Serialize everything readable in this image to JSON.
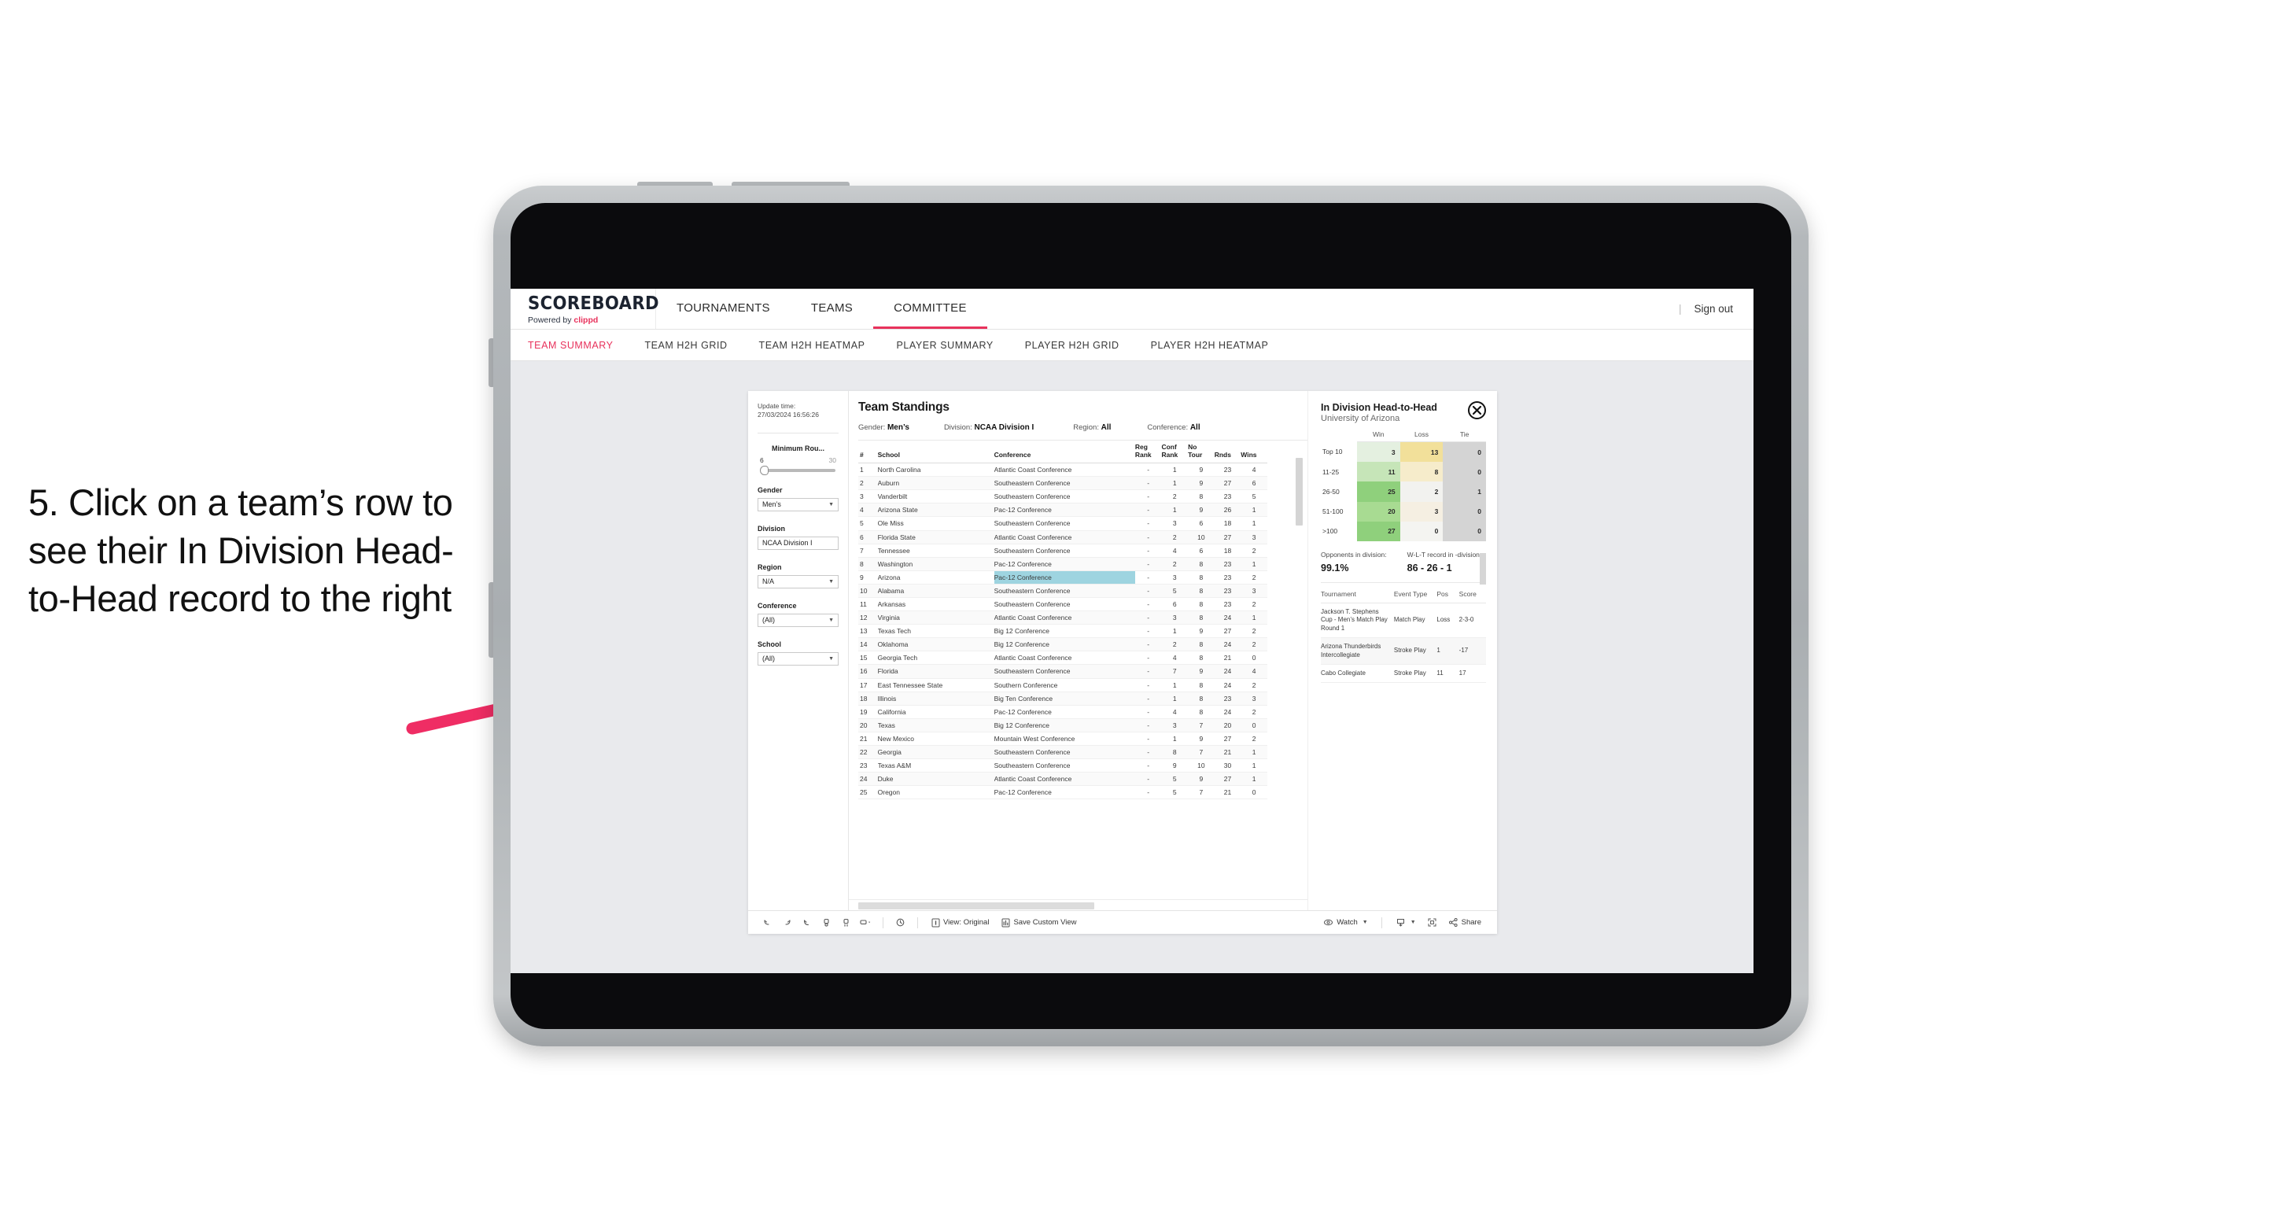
{
  "annotation": {
    "text": "5. Click on a team’s row to see their In Division Head-to-Head record to the right",
    "arrow_color": "#ef2d64"
  },
  "brand": {
    "logo_main": "SCOREBOARD",
    "logo_sub_prefix": "Powered by ",
    "logo_sub_brand": "clippd",
    "accent_color": "#e8325c"
  },
  "topnav": {
    "items": [
      {
        "label": "TOURNAMENTS",
        "active": false
      },
      {
        "label": "TEAMS",
        "active": false
      },
      {
        "label": "COMMITTEE",
        "active": true
      }
    ],
    "divider": "|",
    "sign_out": "Sign out"
  },
  "subnav": {
    "items": [
      {
        "label": "TEAM SUMMARY",
        "active": true
      },
      {
        "label": "TEAM H2H GRID",
        "active": false
      },
      {
        "label": "TEAM H2H HEATMAP",
        "active": false
      },
      {
        "label": "PLAYER SUMMARY",
        "active": false
      },
      {
        "label": "PLAYER H2H GRID",
        "active": false
      },
      {
        "label": "PLAYER H2H HEATMAP",
        "active": false
      }
    ]
  },
  "rail": {
    "update_label": "Update time:",
    "update_value": "27/03/2024 16:56:26",
    "slider": {
      "title": "Minimum Rou...",
      "min": "6",
      "max": "30"
    },
    "filters": [
      {
        "title": "Gender",
        "value": "Men’s"
      },
      {
        "title": "Division",
        "value": "NCAA Division I"
      },
      {
        "title": "Region",
        "value": "N/A"
      },
      {
        "title": "Conference",
        "value": "(All)"
      },
      {
        "title": "School",
        "value": "(All)"
      }
    ]
  },
  "standings": {
    "title": "Team Standings",
    "summary": [
      {
        "label": "Gender:",
        "value": "Men’s"
      },
      {
        "label": "Division:",
        "value": "NCAA Division I"
      },
      {
        "label": "Region:",
        "value": "All"
      },
      {
        "label": "Conference:",
        "value": "All"
      }
    ],
    "columns": [
      "#",
      "School",
      "Conference",
      "Reg Rank",
      "Conf Rank",
      "No Tour",
      "Rnds",
      "Wins"
    ],
    "column_lines": [
      [
        "#",
        ""
      ],
      [
        "School",
        ""
      ],
      [
        "Conference",
        ""
      ],
      [
        "Reg",
        "Rank"
      ],
      [
        "Conf",
        "Rank"
      ],
      [
        "No",
        "Tour"
      ],
      [
        "",
        "Rnds"
      ],
      [
        "",
        "Wins"
      ]
    ],
    "highlighted_row": 9,
    "rows": [
      {
        "n": "1",
        "school": "North Carolina",
        "conf": "Atlantic Coast Conference",
        "reg": "-",
        "cr": "1",
        "nt": "9",
        "rnds": "23",
        "wins": "4"
      },
      {
        "n": "2",
        "school": "Auburn",
        "conf": "Southeastern Conference",
        "reg": "-",
        "cr": "1",
        "nt": "9",
        "rnds": "27",
        "wins": "6"
      },
      {
        "n": "3",
        "school": "Vanderbilt",
        "conf": "Southeastern Conference",
        "reg": "-",
        "cr": "2",
        "nt": "8",
        "rnds": "23",
        "wins": "5"
      },
      {
        "n": "4",
        "school": "Arizona State",
        "conf": "Pac-12 Conference",
        "reg": "-",
        "cr": "1",
        "nt": "9",
        "rnds": "26",
        "wins": "1"
      },
      {
        "n": "5",
        "school": "Ole Miss",
        "conf": "Southeastern Conference",
        "reg": "-",
        "cr": "3",
        "nt": "6",
        "rnds": "18",
        "wins": "1"
      },
      {
        "n": "6",
        "school": "Florida State",
        "conf": "Atlantic Coast Conference",
        "reg": "-",
        "cr": "2",
        "nt": "10",
        "rnds": "27",
        "wins": "3"
      },
      {
        "n": "7",
        "school": "Tennessee",
        "conf": "Southeastern Conference",
        "reg": "-",
        "cr": "4",
        "nt": "6",
        "rnds": "18",
        "wins": "2"
      },
      {
        "n": "8",
        "school": "Washington",
        "conf": "Pac-12 Conference",
        "reg": "-",
        "cr": "2",
        "nt": "8",
        "rnds": "23",
        "wins": "1"
      },
      {
        "n": "9",
        "school": "Arizona",
        "conf": "Pac-12 Conference",
        "reg": "-",
        "cr": "3",
        "nt": "8",
        "rnds": "23",
        "wins": "2"
      },
      {
        "n": "10",
        "school": "Alabama",
        "conf": "Southeastern Conference",
        "reg": "-",
        "cr": "5",
        "nt": "8",
        "rnds": "23",
        "wins": "3"
      },
      {
        "n": "11",
        "school": "Arkansas",
        "conf": "Southeastern Conference",
        "reg": "-",
        "cr": "6",
        "nt": "8",
        "rnds": "23",
        "wins": "2"
      },
      {
        "n": "12",
        "school": "Virginia",
        "conf": "Atlantic Coast Conference",
        "reg": "-",
        "cr": "3",
        "nt": "8",
        "rnds": "24",
        "wins": "1"
      },
      {
        "n": "13",
        "school": "Texas Tech",
        "conf": "Big 12 Conference",
        "reg": "-",
        "cr": "1",
        "nt": "9",
        "rnds": "27",
        "wins": "2"
      },
      {
        "n": "14",
        "school": "Oklahoma",
        "conf": "Big 12 Conference",
        "reg": "-",
        "cr": "2",
        "nt": "8",
        "rnds": "24",
        "wins": "2"
      },
      {
        "n": "15",
        "school": "Georgia Tech",
        "conf": "Atlantic Coast Conference",
        "reg": "-",
        "cr": "4",
        "nt": "8",
        "rnds": "21",
        "wins": "0"
      },
      {
        "n": "16",
        "school": "Florida",
        "conf": "Southeastern Conference",
        "reg": "-",
        "cr": "7",
        "nt": "9",
        "rnds": "24",
        "wins": "4"
      },
      {
        "n": "17",
        "school": "East Tennessee State",
        "conf": "Southern Conference",
        "reg": "-",
        "cr": "1",
        "nt": "8",
        "rnds": "24",
        "wins": "2"
      },
      {
        "n": "18",
        "school": "Illinois",
        "conf": "Big Ten Conference",
        "reg": "-",
        "cr": "1",
        "nt": "8",
        "rnds": "23",
        "wins": "3"
      },
      {
        "n": "19",
        "school": "California",
        "conf": "Pac-12 Conference",
        "reg": "-",
        "cr": "4",
        "nt": "8",
        "rnds": "24",
        "wins": "2"
      },
      {
        "n": "20",
        "school": "Texas",
        "conf": "Big 12 Conference",
        "reg": "-",
        "cr": "3",
        "nt": "7",
        "rnds": "20",
        "wins": "0"
      },
      {
        "n": "21",
        "school": "New Mexico",
        "conf": "Mountain West Conference",
        "reg": "-",
        "cr": "1",
        "nt": "9",
        "rnds": "27",
        "wins": "2"
      },
      {
        "n": "22",
        "school": "Georgia",
        "conf": "Southeastern Conference",
        "reg": "-",
        "cr": "8",
        "nt": "7",
        "rnds": "21",
        "wins": "1"
      },
      {
        "n": "23",
        "school": "Texas A&M",
        "conf": "Southeastern Conference",
        "reg": "-",
        "cr": "9",
        "nt": "10",
        "rnds": "30",
        "wins": "1"
      },
      {
        "n": "24",
        "school": "Duke",
        "conf": "Atlantic Coast Conference",
        "reg": "-",
        "cr": "5",
        "nt": "9",
        "rnds": "27",
        "wins": "1"
      },
      {
        "n": "25",
        "school": "Oregon",
        "conf": "Pac-12 Conference",
        "reg": "-",
        "cr": "5",
        "nt": "7",
        "rnds": "21",
        "wins": "0"
      }
    ]
  },
  "h2h": {
    "title": "In Division Head-to-Head",
    "subtitle": "University of Arizona",
    "close_icon": "close-icon",
    "columns": [
      "Win",
      "Loss",
      "Tie"
    ],
    "rows": [
      {
        "label": "Top 10",
        "win": "3",
        "loss": "13",
        "tie": "0",
        "win_bg": "#e4f0e0",
        "loss_bg": "#f2e09a",
        "tie_bg": "#d4d4d4"
      },
      {
        "label": "11-25",
        "win": "11",
        "loss": "8",
        "tie": "0",
        "win_bg": "#c6e5b8",
        "loss_bg": "#f6eccb",
        "tie_bg": "#d4d4d4"
      },
      {
        "label": "26-50",
        "win": "25",
        "loss": "2",
        "tie": "1",
        "win_bg": "#8fd07c",
        "loss_bg": "#f2f2ef",
        "tie_bg": "#d4d4d4"
      },
      {
        "label": "51-100",
        "win": "20",
        "loss": "3",
        "tie": "0",
        "win_bg": "#a8db92",
        "loss_bg": "#f5efe2",
        "tie_bg": "#d4d4d4"
      },
      {
        "label": ">100",
        "win": "27",
        "loss": "0",
        "tie": "0",
        "win_bg": "#8fd07c",
        "loss_bg": "#f4f4f1",
        "tie_bg": "#d4d4d4"
      }
    ],
    "stats": [
      {
        "label": "Opponents in division:",
        "value": "99.1%"
      },
      {
        "label": "W-L-T record in -division:",
        "value": "86 - 26 - 1"
      }
    ],
    "tournament_columns": [
      "Tournament",
      "Event Type",
      "Pos",
      "Score"
    ],
    "tournaments": [
      {
        "name": "Jackson T. Stephens Cup - Men’s Match Play Round 1",
        "type": "Match Play",
        "pos": "Loss",
        "score": "2-3-0"
      },
      {
        "name": "Arizona Thunderbirds Intercollegiate",
        "type": "Stroke Play",
        "pos": "1",
        "score": "-17"
      },
      {
        "name": "Cabo Collegiate",
        "type": "Stroke Play",
        "pos": "11",
        "score": "17"
      }
    ]
  },
  "toolbar": {
    "icons": [
      "undo-icon",
      "redo-icon",
      "revert-icon",
      "refresh-icon",
      "pause-icon",
      "rectangle-select-icon"
    ],
    "clock_icon": "clock-icon",
    "view_label": "View: Original",
    "save_view_label": "Save Custom View",
    "watch_label": "Watch",
    "download_icon": "download-icon",
    "fullscreen_icon": "fullscreen-icon",
    "share_label": "Share"
  }
}
